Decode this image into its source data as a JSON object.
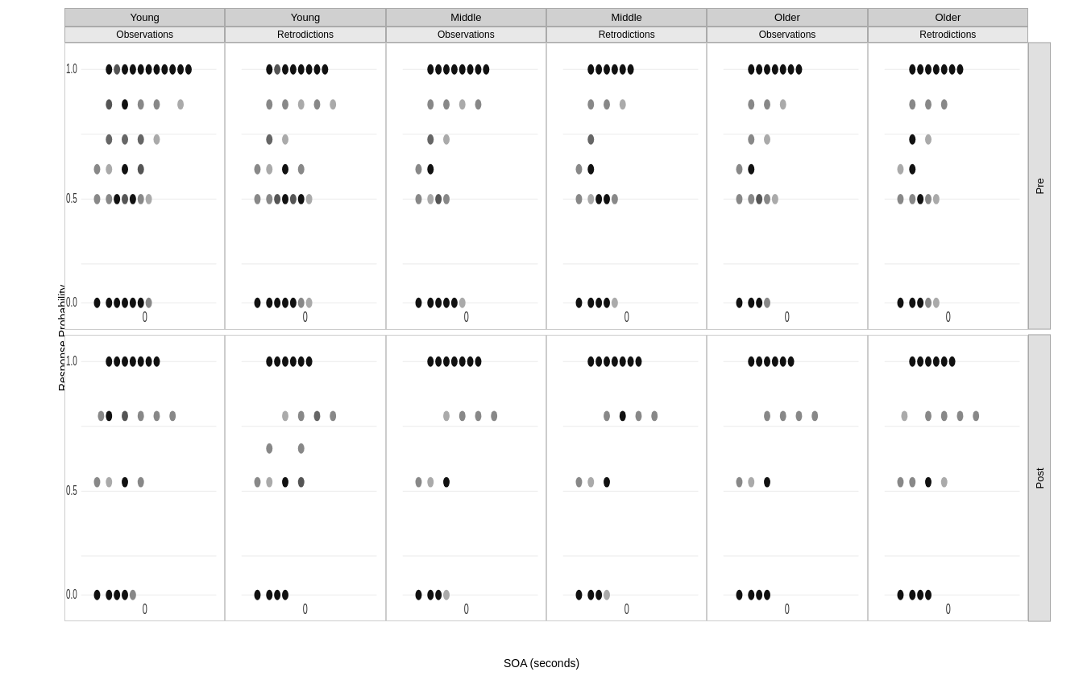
{
  "chart": {
    "title": "",
    "y_axis_label": "Response Probability",
    "x_axis_label": "SOA (seconds)",
    "columns": [
      {
        "top": "Young",
        "sub": "Observations"
      },
      {
        "top": "Young",
        "sub": "Retrodictions"
      },
      {
        "top": "Middle",
        "sub": "Observations"
      },
      {
        "top": "Middle",
        "sub": "Retrodictions"
      },
      {
        "top": "Older",
        "sub": "Observations"
      },
      {
        "top": "Older",
        "sub": "Retrodictions"
      }
    ],
    "rows": [
      {
        "label": "Pre"
      },
      {
        "label": "Post"
      }
    ],
    "y_ticks": [
      "1.0",
      "0.5",
      "0.0"
    ],
    "x_tick": "0"
  }
}
